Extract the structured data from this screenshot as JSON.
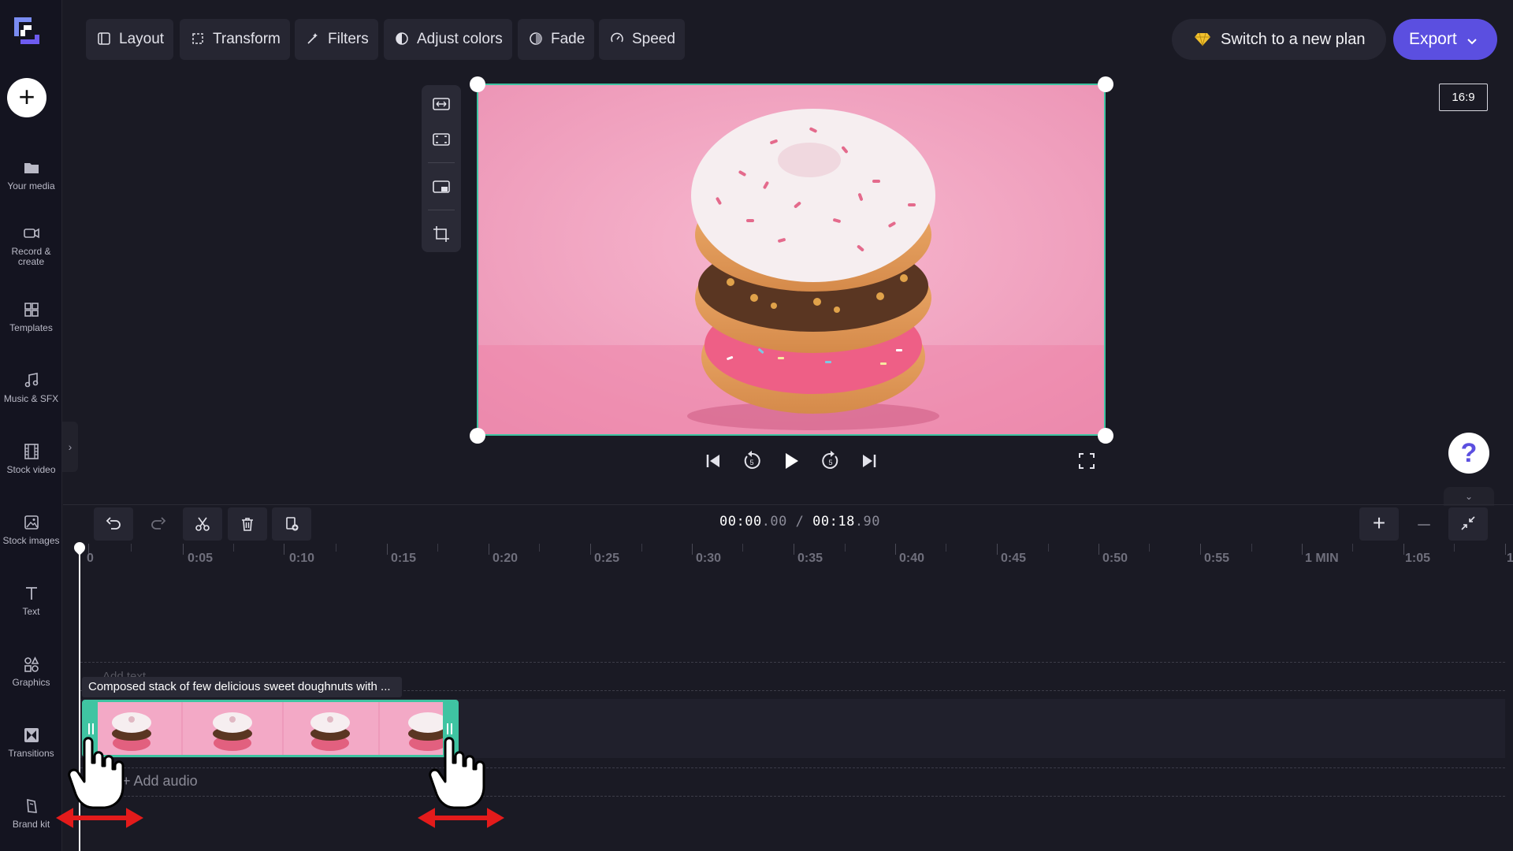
{
  "sidebar": {
    "items": [
      {
        "label": "Your media",
        "icon": "folder-icon"
      },
      {
        "label": "Record &\ncreate",
        "icon": "video-camera-icon"
      },
      {
        "label": "Templates",
        "icon": "templates-icon"
      },
      {
        "label": "Music & SFX",
        "icon": "music-note-icon"
      },
      {
        "label": "Stock video",
        "icon": "film-icon"
      },
      {
        "label": "Stock images",
        "icon": "image-icon"
      },
      {
        "label": "Text",
        "icon": "text-icon"
      },
      {
        "label": "Graphics",
        "icon": "shapes-icon"
      },
      {
        "label": "Transitions",
        "icon": "transitions-icon"
      },
      {
        "label": "Brand kit",
        "icon": "brand-kit-icon"
      }
    ],
    "add_symbol": "+"
  },
  "toolbar": {
    "layout": "Layout",
    "transform": "Transform",
    "filters": "Filters",
    "adjust_colors": "Adjust colors",
    "fade": "Fade",
    "speed": "Speed",
    "plan": "Switch to a new plan",
    "export": "Export"
  },
  "preview": {
    "aspect_ratio": "16:9"
  },
  "help": {
    "symbol": "?"
  },
  "timeline": {
    "current_time_main": "00:00",
    "current_time_frac": ".00",
    "separator": " / ",
    "total_time_main": "00:18",
    "total_time_frac": ".90",
    "zoom_in": "+",
    "zoom_out": "–",
    "ruler_labels": [
      "0",
      "0:05",
      "0:10",
      "0:15",
      "0:20",
      "0:25",
      "0:30",
      "0:35",
      "0:40",
      "0:45",
      "0:50",
      "0:55",
      "1 MIN",
      "1:05",
      "1"
    ],
    "clip_title": "Composed stack of few delicious sweet doughnuts with ...",
    "add_text": "Add text",
    "add_audio": "+ Add audio"
  },
  "colors": {
    "accent": "#5b4fe0",
    "selection": "#3fc4a2",
    "background": "#1a1a24",
    "annotation_red": "#e41b1b",
    "preview_pink": "#f2a4c2"
  }
}
